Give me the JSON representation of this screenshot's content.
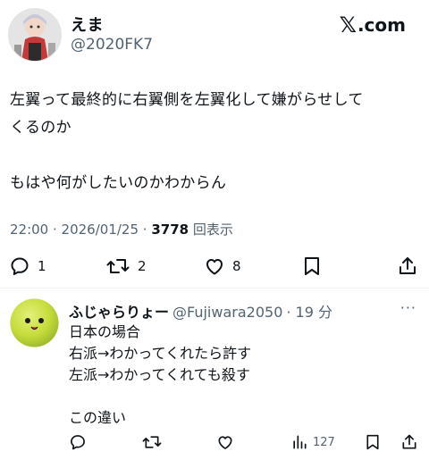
{
  "author": {
    "display_name": "えま",
    "handle": "@2020FK7",
    "avatar_icon": "anime-character-avatar"
  },
  "site_logo": {
    "mark": "𝕏",
    "text": ".com"
  },
  "tweet": {
    "text": "左翼って最終的に右翼側を左翼化して嫌がらせして\nくるのか\n\nもはや何がしたいのかわからん",
    "time": "22:00",
    "separator1": " · ",
    "date": "2026/01/25",
    "separator2": " · ",
    "views": "3778",
    "views_label": " 回表示"
  },
  "actions": {
    "reply_count": "1",
    "retweet_count": "2",
    "like_count": "8",
    "icons": [
      "reply-icon",
      "retweet-icon",
      "like-icon",
      "bookmark-icon",
      "share-icon"
    ]
  },
  "reply": {
    "display_name": "ふじゃらりょー",
    "handle": "@Fujiwara2050",
    "time": "· 19 分",
    "more": "···",
    "text": "日本の場合\n右派→わかってくれたら許す\n左派→わかってくれても殺す\n\nこの違い",
    "view_count": "127",
    "avatar_icon": "green-ball-face-avatar"
  },
  "colors": {
    "text": "#0f1419",
    "secondary": "#536471",
    "divider": "#eff3f4",
    "reply_avatar": "#c5dc3a"
  }
}
